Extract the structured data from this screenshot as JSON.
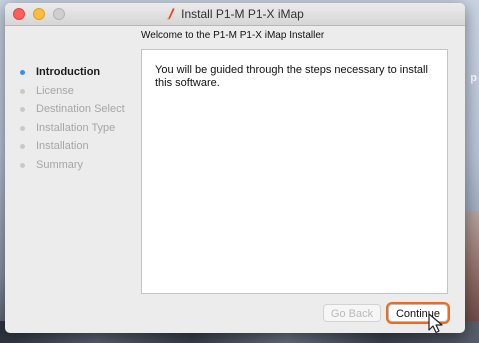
{
  "desktop": {
    "edge_fragment": "p"
  },
  "window": {
    "title": "Install P1-M P1-X iMap",
    "title_icon": "installer-package-icon",
    "subtitle": "Welcome to the P1-M P1-X iMap Installer"
  },
  "sidebar": {
    "steps": [
      {
        "label": "Introduction",
        "active": true
      },
      {
        "label": "License",
        "active": false
      },
      {
        "label": "Destination Select",
        "active": false
      },
      {
        "label": "Installation Type",
        "active": false
      },
      {
        "label": "Installation",
        "active": false
      },
      {
        "label": "Summary",
        "active": false
      }
    ]
  },
  "content": {
    "body": "You will be guided through the steps necessary to install this software."
  },
  "buttons": {
    "back_label": "Go Back",
    "back_enabled": false,
    "continue_label": "Continue"
  },
  "colors": {
    "active_step_dot": "#3b8ee6",
    "highlight": "#f06a1b",
    "close": "#fc605c",
    "minimize": "#fdbc40"
  }
}
